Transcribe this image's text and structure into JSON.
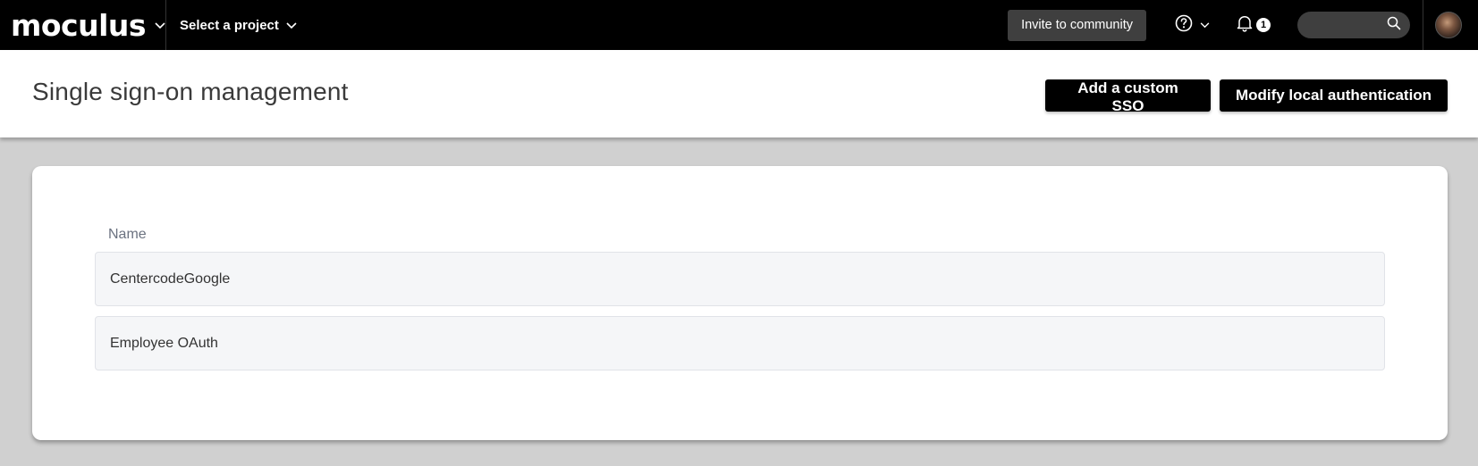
{
  "nav": {
    "brand": "moculus",
    "project_select": "Select a project",
    "invite_label": "Invite to community",
    "notification_count": "1",
    "icons": [
      "chevron-down-icon",
      "help-icon",
      "bell-icon",
      "search-icon",
      "avatar"
    ]
  },
  "header": {
    "title": "Single sign-on management",
    "add_sso_label": "Add a custom SSO",
    "modify_local_label": "Modify local authentication"
  },
  "table": {
    "column_name": "Name",
    "rows": [
      {
        "name": "CentercodeGoogle"
      },
      {
        "name": "Employee OAuth"
      }
    ]
  },
  "colors": {
    "nav_bg": "#000000",
    "page_bg": "#d0d0d0",
    "button_bg": "#000000",
    "row_bg": "#f5f6f8"
  }
}
